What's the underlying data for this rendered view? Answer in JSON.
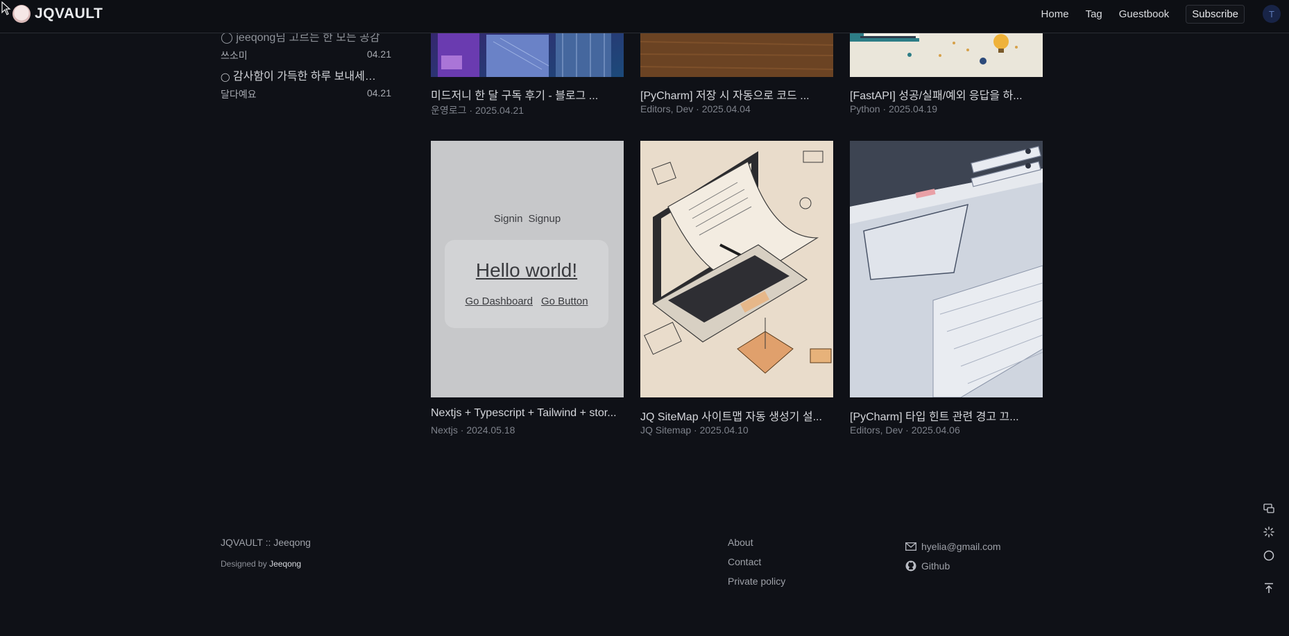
{
  "header": {
    "logo_text": "JQVAULT",
    "nav": [
      "Home",
      "Tag",
      "Guestbook"
    ],
    "subscribe_label": "Subscribe",
    "user_initial": "T"
  },
  "comments": [
    {
      "text": "jeeqong님 고르는 한 모든 공감 ...",
      "author": "",
      "date": ""
    },
    {
      "text": "jeeqong님 고르는 한 모든 공감",
      "author": "쓰소미",
      "date": "04.21"
    },
    {
      "text": "감사함이 가득한 하루 보내세요! ...",
      "author": "달다예요",
      "date": "04.21"
    }
  ],
  "posts_top": [
    {
      "title": "미드저니 한 달 구독 후기 - 블로그 ...",
      "meta": "운영로그 · 2025.04.21"
    },
    {
      "title": "[PyCharm] 저장 시 자동으로 코드 ...",
      "meta": "Editors, Dev · 2025.04.04"
    },
    {
      "title": "[FastAPI] 성공/실패/예외 응답을 하...",
      "meta": "Python · 2025.04.19"
    }
  ],
  "posts_bottom": [
    {
      "title": "Nextjs + Typescript + Tailwind + stor...",
      "meta": "Nextjs · 2024.05.18"
    },
    {
      "title": "JQ SiteMap 사이트맵 자동 생성기 설...",
      "meta": "JQ Sitemap · 2025.04.10"
    },
    {
      "title": "[PyCharm] 타입 힌트 관련 경고 끄...",
      "meta": "Editors, Dev · 2025.04.06"
    }
  ],
  "hello_thumb": {
    "signin": "Signin",
    "signup": "Signup",
    "hello": "Hello world!",
    "go_dashboard": "Go Dashboard",
    "go_button": "Go Button"
  },
  "footer": {
    "brand": "JQVAULT :: Jeeqong",
    "designed_by_prefix": "Designed by",
    "designed_by_name": "Jeeqong",
    "links": [
      "About",
      "Contact",
      "Private policy"
    ],
    "email": "hyelia@gmail.com",
    "github": "Github"
  },
  "colors": {
    "background": "#0f1117",
    "header_bg": "#0d0f14",
    "text": "#d4d6db",
    "muted": "#7e828b"
  },
  "icons": [
    "cursor-icon",
    "logo-avatar",
    "comment-icon",
    "mail-icon",
    "github-icon",
    "comment-float-icon",
    "loading-icon",
    "theme-icon",
    "scroll-top-icon"
  ]
}
